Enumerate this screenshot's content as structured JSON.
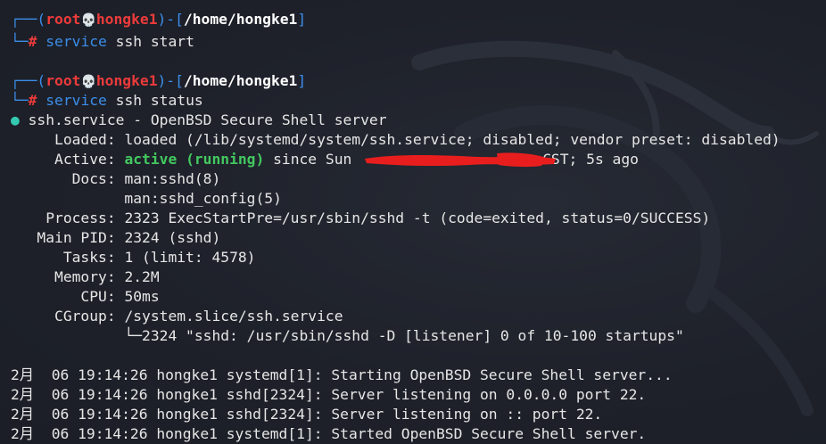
{
  "prompt1": {
    "box_top": "┌──(",
    "user": "root",
    "skull": "💀",
    "host": "hongke1",
    "mid": ")-[",
    "path": "/home/hongke1",
    "close": "]",
    "box_bottom": "└─",
    "hash": "#",
    "cmd": "service",
    "args": " ssh start"
  },
  "prompt2": {
    "box_top": "┌──(",
    "user": "root",
    "skull": "💀",
    "host": "hongke1",
    "mid": ")-[",
    "path": "/home/hongke1",
    "close": "]",
    "box_bottom": "└─",
    "hash": "#",
    "cmd": "service",
    "args": " ssh status"
  },
  "status": {
    "bullet": "●",
    "header": " ssh.service - OpenBSD Secure Shell server",
    "loaded_key": "     Loaded:",
    "loaded_val": " loaded (/lib/systemd/system/ssh.service; disabled; vendor preset: disabled)",
    "active_key": "     Active:",
    "active_state": "active (running)",
    "active_since": " since Sun ",
    "active_tail": "CST; 5s ago",
    "docs_key": "       Docs:",
    "docs_val1": " man:sshd(8)",
    "docs_val2": "             man:sshd_config(5)",
    "process_key": "    Process:",
    "process_val": " 2323 ExecStartPre=/usr/sbin/sshd -t (code=exited, status=0/SUCCESS)",
    "mainpid_key": "   Main PID:",
    "mainpid_val": " 2324 (sshd)",
    "tasks_key": "      Tasks:",
    "tasks_val": " 1 (limit: 4578)",
    "memory_key": "     Memory:",
    "memory_val": " 2.2M",
    "cpu_key": "        CPU:",
    "cpu_val": " 50ms",
    "cgroup_key": "     CGroup:",
    "cgroup_val": " /system.slice/ssh.service",
    "cgroup_child": "             └─2324 \"sshd: /usr/sbin/sshd -D [listener] 0 of 10-100 startups\""
  },
  "log": [
    "2月  06 19:14:26 hongke1 systemd[1]: Starting OpenBSD Secure Shell server...",
    "2月  06 19:14:26 hongke1 sshd[2324]: Server listening on 0.0.0.0 port 22.",
    "2月  06 19:14:26 hongke1 sshd[2324]: Server listening on :: port 22.",
    "2月  06 19:14:26 hongke1 systemd[1]: Started OpenBSD Secure Shell server."
  ],
  "colors": {
    "background": "#1d2028",
    "prompt_blue": "#3b8eea",
    "prompt_red": "#ec3b3b",
    "active_green": "#43c85f",
    "bullet_cyan": "#34c9b0",
    "redaction_red": "#e81e1e"
  },
  "icons": {
    "skull": "skull-icon",
    "bullet": "status-dot-icon"
  }
}
